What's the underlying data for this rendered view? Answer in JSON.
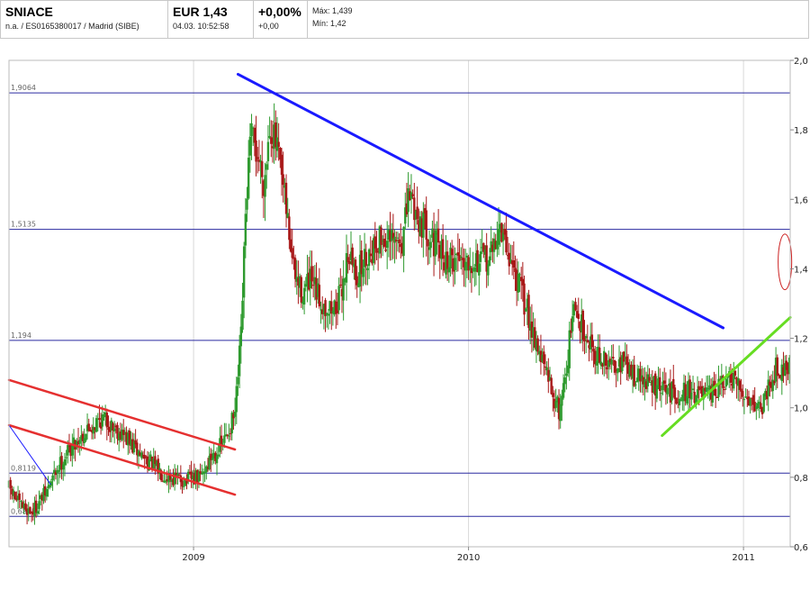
{
  "header": {
    "ticker": "SNIACE",
    "subtitle": "n.a. / ES0165380017 / Madrid (SIBE)",
    "price": "EUR 1,43",
    "timestamp": "04.03. 10:52:58",
    "change_pct": "+0,00%",
    "change_abs": "+0,00",
    "max": "Máx: 1,439",
    "min": "Mín: 1,42"
  },
  "chart_data": {
    "type": "candlestick",
    "title": "",
    "xlabel": "",
    "ylabel": "",
    "ylim": [
      0.6,
      2.0
    ],
    "x_domain": [
      "2008-05-01",
      "2011-03-04"
    ],
    "y_ticks": [
      "0,6",
      "0,8",
      "1,0",
      "1,2",
      "1,4",
      "1,6",
      "1,8",
      "2,0"
    ],
    "y_tick_values": [
      0.6,
      0.8,
      1.0,
      1.2,
      1.4,
      1.6,
      1.8,
      2.0
    ],
    "x_ticks": [
      {
        "label": "2009",
        "date": "2009-01-01"
      },
      {
        "label": "2010",
        "date": "2010-01-01"
      },
      {
        "label": "2011",
        "date": "2011-01-01"
      }
    ],
    "grid": "vertical at year ticks",
    "levels": [
      {
        "label": "1,9064",
        "value": 1.9064
      },
      {
        "label": "1,5135",
        "value": 1.5135
      },
      {
        "label": "1,194",
        "value": 1.194
      },
      {
        "label": "0,8119",
        "value": 0.8119
      },
      {
        "label": "0,6875",
        "value": 0.6875
      }
    ],
    "trendlines": [
      {
        "color": "#1a1aff",
        "width": 3,
        "from": [
          "2009-03-01",
          1.96
        ],
        "to": [
          "2010-12-05",
          1.23
        ]
      },
      {
        "color": "#e53030",
        "width": 2.5,
        "from": [
          "2008-05-01",
          1.08
        ],
        "to": [
          "2009-02-25",
          0.88
        ]
      },
      {
        "color": "#e53030",
        "width": 2.5,
        "from": [
          "2008-05-01",
          0.95
        ],
        "to": [
          "2009-02-25",
          0.75
        ]
      },
      {
        "color": "#66dd22",
        "width": 3,
        "from": [
          "2010-09-15",
          0.92
        ],
        "to": [
          "2011-03-04",
          1.26
        ]
      },
      {
        "color": "#1a1aff",
        "width": 1,
        "from": [
          "2008-05-01",
          0.95
        ],
        "to": [
          "2008-06-25",
          0.78
        ]
      }
    ],
    "annotations": [
      {
        "shape": "ellipse",
        "color": "#cc2222",
        "center": [
          "2011-02-25",
          1.42
        ],
        "rx_days": 9,
        "ry": 0.08
      }
    ],
    "price_path": [
      [
        "2008-05-01",
        0.77
      ],
      [
        "2008-05-15",
        0.72
      ],
      [
        "2008-06-01",
        0.7
      ],
      [
        "2008-06-20",
        0.76
      ],
      [
        "2008-07-05",
        0.83
      ],
      [
        "2008-07-20",
        0.88
      ],
      [
        "2008-08-05",
        0.92
      ],
      [
        "2008-08-20",
        0.95
      ],
      [
        "2008-09-01",
        0.97
      ],
      [
        "2008-09-15",
        0.95
      ],
      [
        "2008-10-01",
        0.92
      ],
      [
        "2008-10-15",
        0.88
      ],
      [
        "2008-11-01",
        0.85
      ],
      [
        "2008-11-15",
        0.82
      ],
      [
        "2008-12-01",
        0.8
      ],
      [
        "2008-12-20",
        0.79
      ],
      [
        "2009-01-10",
        0.8
      ],
      [
        "2009-01-25",
        0.86
      ],
      [
        "2009-02-10",
        0.9
      ],
      [
        "2009-02-25",
        0.98
      ],
      [
        "2009-03-05",
        1.2
      ],
      [
        "2009-03-12",
        1.6
      ],
      [
        "2009-03-18",
        1.78
      ],
      [
        "2009-03-28",
        1.72
      ],
      [
        "2009-04-05",
        1.65
      ],
      [
        "2009-04-12",
        1.82
      ],
      [
        "2009-04-22",
        1.74
      ],
      [
        "2009-05-05",
        1.55
      ],
      [
        "2009-05-15",
        1.38
      ],
      [
        "2009-05-25",
        1.33
      ],
      [
        "2009-06-05",
        1.36
      ],
      [
        "2009-06-20",
        1.3
      ],
      [
        "2009-07-05",
        1.28
      ],
      [
        "2009-07-15",
        1.32
      ],
      [
        "2009-07-25",
        1.45
      ],
      [
        "2009-08-05",
        1.38
      ],
      [
        "2009-08-20",
        1.44
      ],
      [
        "2009-09-05",
        1.49
      ],
      [
        "2009-09-20",
        1.47
      ],
      [
        "2009-10-05",
        1.48
      ],
      [
        "2009-10-15",
        1.62
      ],
      [
        "2009-10-25",
        1.55
      ],
      [
        "2009-11-05",
        1.52
      ],
      [
        "2009-11-20",
        1.46
      ],
      [
        "2009-12-05",
        1.42
      ],
      [
        "2009-12-20",
        1.44
      ],
      [
        "2010-01-05",
        1.43
      ],
      [
        "2010-01-20",
        1.42
      ],
      [
        "2010-02-01",
        1.44
      ],
      [
        "2010-02-10",
        1.52
      ],
      [
        "2010-02-20",
        1.46
      ],
      [
        "2010-03-05",
        1.38
      ],
      [
        "2010-03-20",
        1.28
      ],
      [
        "2010-04-05",
        1.16
      ],
      [
        "2010-04-20",
        1.06
      ],
      [
        "2010-05-01",
        0.99
      ],
      [
        "2010-05-10",
        1.1
      ],
      [
        "2010-05-20",
        1.28
      ],
      [
        "2010-06-05",
        1.22
      ],
      [
        "2010-06-20",
        1.15
      ],
      [
        "2010-07-05",
        1.12
      ],
      [
        "2010-07-20",
        1.14
      ],
      [
        "2010-08-05",
        1.1
      ],
      [
        "2010-08-20",
        1.08
      ],
      [
        "2010-09-05",
        1.06
      ],
      [
        "2010-09-20",
        1.05
      ],
      [
        "2010-10-05",
        1.04
      ],
      [
        "2010-10-20",
        1.05
      ],
      [
        "2010-11-01",
        1.04
      ],
      [
        "2010-11-15",
        1.03
      ],
      [
        "2010-12-01",
        1.06
      ],
      [
        "2010-12-15",
        1.08
      ],
      [
        "2011-01-01",
        1.04
      ],
      [
        "2011-01-10",
        1.03
      ],
      [
        "2011-01-25",
        1.0
      ],
      [
        "2011-02-05",
        1.08
      ],
      [
        "2011-02-15",
        1.12
      ],
      [
        "2011-02-25",
        1.11
      ],
      [
        "2011-03-04",
        1.14
      ]
    ]
  }
}
